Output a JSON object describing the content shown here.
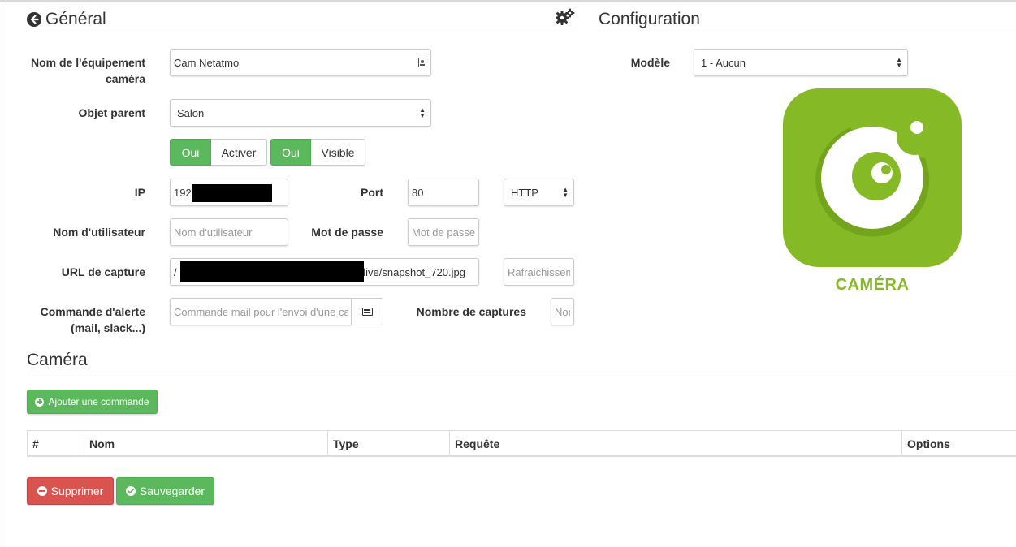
{
  "general": {
    "title": "Général",
    "fields": {
      "name_label": "Nom de l'équipement caméra",
      "name_value": "Cam Netatmo",
      "parent_label": "Objet parent",
      "parent_value": "Salon",
      "activate_on": "Oui",
      "activate_label": "Activer",
      "visible_on": "Oui",
      "visible_label": "Visible",
      "ip_label": "IP",
      "ip_value": "192",
      "port_label": "Port",
      "port_value": "80",
      "protocol_value": "HTTP",
      "user_label": "Nom d'utilisateur",
      "user_placeholder": "Nom d'utilisateur",
      "password_label": "Mot de passe",
      "password_placeholder": "Mot de passe",
      "url_label": "URL de capture",
      "url_prefix": "/",
      "url_suffix": "/live/snapshot_720.jpg",
      "refresh_placeholder": "Rafraichissement",
      "alert_label": "Commande d'alerte (mail, slack...)",
      "alert_placeholder": "Commande mail pour l'envoi d'une capture",
      "captures_label": "Nombre de captures",
      "captures_placeholder": "Nombre"
    }
  },
  "configuration": {
    "title": "Configuration",
    "model_label": "Modèle",
    "model_value": "1 - Aucun",
    "logo_text": "CAMÉRA"
  },
  "camera": {
    "title": "Caméra",
    "add_button": "Ajouter une commande",
    "table_headers": [
      "#",
      "Nom",
      "Type",
      "Requête",
      "Options"
    ]
  },
  "actions": {
    "delete_label": "Supprimer",
    "save_label": "Sauvegarder"
  },
  "colors": {
    "success": "#5cb85c",
    "danger": "#d9534f",
    "logo_green": "#86b926"
  },
  "icons": {
    "back": "arrow-circle-left-icon",
    "settings": "gears-icon",
    "addressbook": "contact-card-icon",
    "list": "list-icon",
    "plus": "plus-circle-icon",
    "minus": "minus-circle-icon",
    "check": "check-circle-icon"
  }
}
